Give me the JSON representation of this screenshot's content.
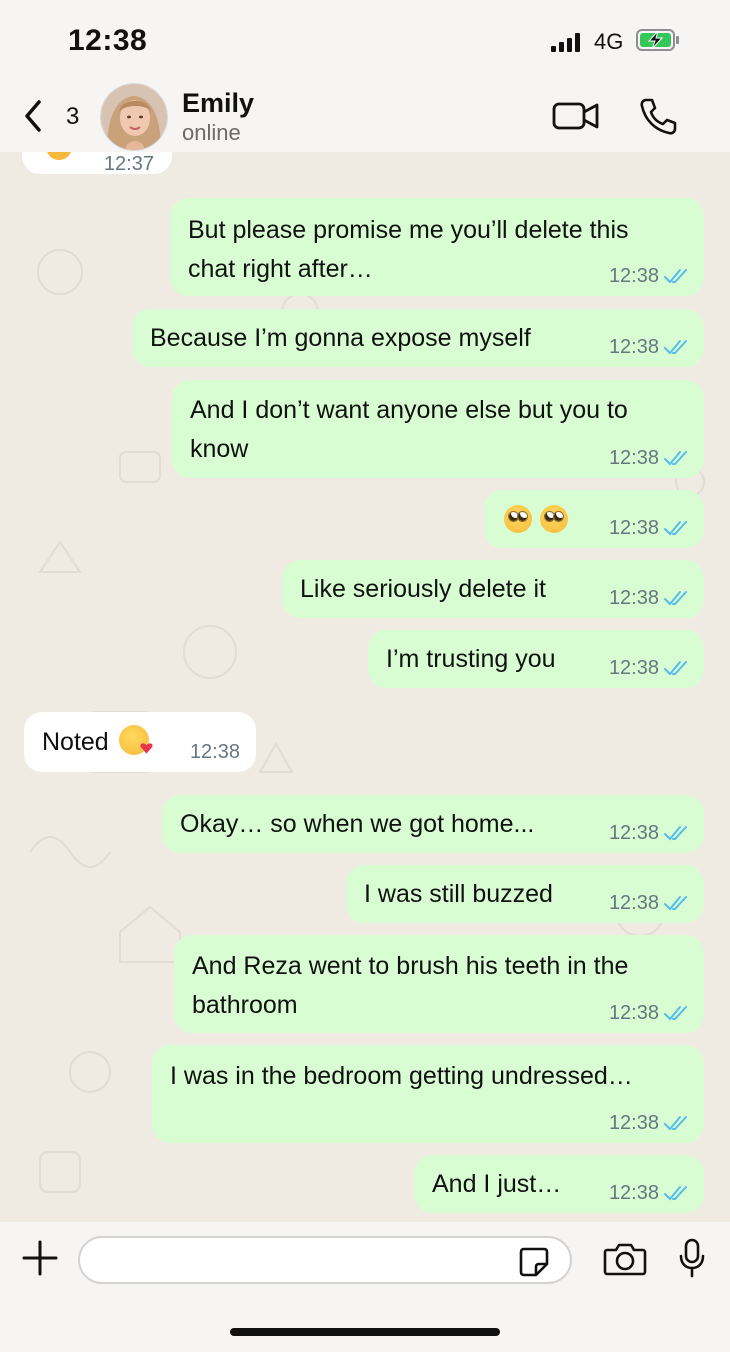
{
  "status_bar": {
    "time": "12:38",
    "network": "4G"
  },
  "header": {
    "back_count": "3",
    "contact_name": "Emily",
    "contact_status": "online"
  },
  "chat": {
    "prev_time": "12:37",
    "messages": [
      {
        "direction": "out",
        "lines": [
          "But please promise me you’ll delete this",
          "chat right after…"
        ],
        "time": "12:38",
        "read": true
      },
      {
        "direction": "out",
        "lines": [
          "Because I’m gonna expose myself"
        ],
        "time": "12:38",
        "read": true
      },
      {
        "direction": "out",
        "lines": [
          "And I don’t want anyone else but you to",
          "know"
        ],
        "time": "12:38",
        "read": true
      },
      {
        "direction": "out",
        "emoji": [
          "face-with-rolling-eyes",
          "face-with-rolling-eyes"
        ],
        "time": "12:38",
        "read": true
      },
      {
        "direction": "out",
        "lines": [
          "Like seriously delete it"
        ],
        "time": "12:38",
        "read": true
      },
      {
        "direction": "out",
        "lines": [
          "I’m trusting you"
        ],
        "time": "12:38",
        "read": true
      },
      {
        "direction": "in",
        "lines": [
          "Noted"
        ],
        "emoji": [
          "face-blowing-a-kiss"
        ],
        "time": "12:38"
      },
      {
        "direction": "out",
        "lines": [
          "Okay… so when we got home..."
        ],
        "time": "12:38",
        "read": true
      },
      {
        "direction": "out",
        "lines": [
          "I was still buzzed"
        ],
        "time": "12:38",
        "read": true
      },
      {
        "direction": "out",
        "lines": [
          "And Reza went to brush his teeth in the",
          "bathroom"
        ],
        "time": "12:38",
        "read": true
      },
      {
        "direction": "out",
        "lines": [
          "I was in the bedroom getting undressed…"
        ],
        "time": "12:38",
        "read": true
      },
      {
        "direction": "out",
        "lines": [
          "And I just…"
        ],
        "time": "12:38",
        "read": true
      }
    ]
  },
  "composer": {
    "input_value": ""
  },
  "colors": {
    "outgoing_bubble": "#d9fdd3",
    "incoming_bubble": "#ffffff",
    "chat_background": "#efeae2",
    "read_tick": "#53bdeb",
    "bar_background": "#f6f5f3"
  },
  "icons": [
    "back-chevron-icon",
    "video-call-icon",
    "voice-call-icon",
    "plus-icon",
    "sticker-icon",
    "camera-icon",
    "microphone-icon",
    "double-check-icon",
    "signal-icon",
    "battery-charging-icon"
  ]
}
